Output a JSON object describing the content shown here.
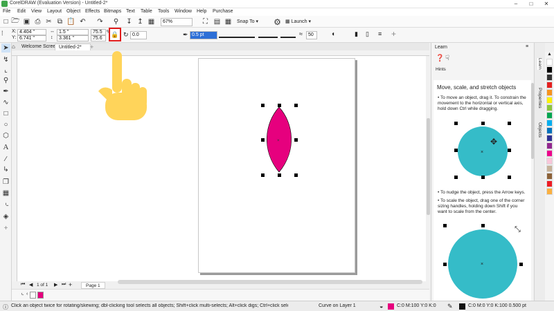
{
  "app": {
    "title": "CorelDRAW (Evaluation Version) - Untitled-2*"
  },
  "menu": [
    "File",
    "Edit",
    "View",
    "Layout",
    "Object",
    "Effects",
    "Bitmaps",
    "Text",
    "Table",
    "Tools",
    "Window",
    "Help",
    "Purchase"
  ],
  "toolbar": {
    "zoom": "67%",
    "snap_to": "Snap To",
    "launch": "Launch"
  },
  "propbar": {
    "x_label": "X:",
    "x_value": "4.404 \"",
    "y_label": "Y:",
    "y_value": "6.741 \"",
    "w_value": "1.5 \"",
    "h_value": "3.361 \"",
    "scale_w": "75.5",
    "scale_h": "75.6",
    "angle": "0.0",
    "outline_width": "0.5 pt",
    "smooth": "50"
  },
  "tabs": {
    "welcome": "Welcome Screen",
    "doc": "Untitled-2*"
  },
  "pagenav": {
    "page_count": "1 of 1",
    "page_tab": "Page 1"
  },
  "learn": {
    "title": "Learn",
    "hints_label": "Hints",
    "heading": "Move, scale, and stretch objects",
    "bullet1": "To move an object, drag it. To constrain the movement to the horizontal or vertical axis, hold down Ctrl while dragging.",
    "bullet2": "To nudge the object, press the Arrow keys.",
    "bullet3": "To scale the object, drag one of the corner sizing handles, holding down Shift if you want to scale from the center."
  },
  "side_tabs": [
    "Learn",
    "Properties",
    "Objects"
  ],
  "status": {
    "hint": "Click an object twice for rotating/skewing; dbl-clicking tool selects all objects; Shift+click multi-selects; Alt+click digs; Ctrl+click selects in a group",
    "layer": "Curve on Layer 1",
    "fill": "C:0 M:100 Y:0 K:0",
    "outline": "C:0 M:0 Y:0 K:100  0.500 pt"
  },
  "colors": {
    "shape_fill": "#e6007e",
    "learn_circle": "#35bcc8",
    "highlight_box": "#e01b1b",
    "hand": "#ffd45a",
    "palette": [
      "#ffffff",
      "#000000",
      "#333333",
      "#e41f1f",
      "#f7931e",
      "#fff200",
      "#8dc63f",
      "#00a651",
      "#00aeef",
      "#0072bc",
      "#2e3192",
      "#92278f",
      "#ec008c",
      "#f9c6d9",
      "#c7b299",
      "#8c6239",
      "#ed1c24",
      "#fbb040"
    ]
  }
}
